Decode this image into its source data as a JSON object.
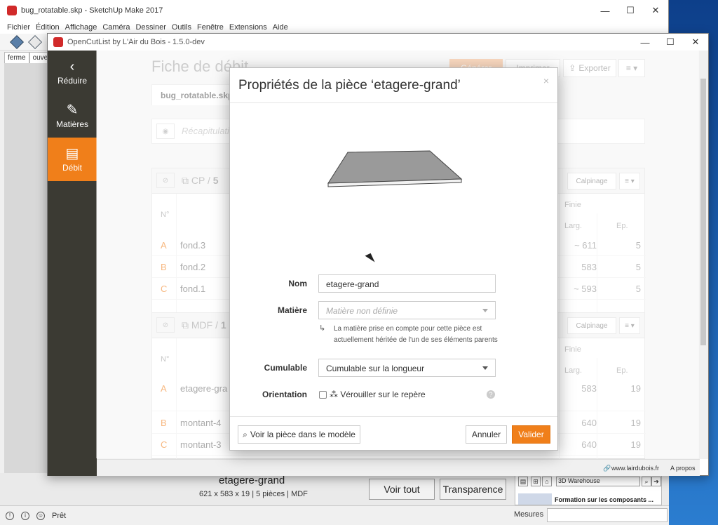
{
  "sketchup": {
    "title": "bug_rotatable.skp - SketchUp Make 2017",
    "menu": [
      "Fichier",
      "Édition",
      "Affichage",
      "Caméra",
      "Dessiner",
      "Outils",
      "Fenêtre",
      "Extensions",
      "Aide"
    ],
    "scene_tabs": [
      "ferme",
      "ouvert"
    ],
    "selected_piece": "etagere-grand",
    "selected_dims": "621 x 583 x 19 | 5 pièces | MDF",
    "btn_voir_tout": "Voir tout",
    "btn_transparence": "Transparence",
    "warehouse_field": "3D Warehouse",
    "warehouse_promo": "Formation sur les composants ...",
    "status": "Prêt",
    "mesures_label": "Mesures"
  },
  "ocl": {
    "title": "OpenCutList by L'Air du Bois - 1.5.0-dev",
    "sidebar": [
      {
        "label": "Réduire",
        "icon": "‹"
      },
      {
        "label": "Matières",
        "icon": "✎"
      },
      {
        "label": "Débit",
        "icon": "▤"
      }
    ],
    "page_title": "Fiche de débit",
    "btn_generate": "Générer",
    "btn_print": "Imprimer",
    "btn_export": "Exporter",
    "file_tab": "bug_rotatable.skp",
    "recap_label": "Récapitulatif",
    "btn_calpinage": "Calpinage",
    "col_num": "N°",
    "col_finie": "Finie",
    "col_larg": "Larg.",
    "col_ep": "Ep.",
    "groups": [
      {
        "name": "CP",
        "count": "5",
        "rows": [
          {
            "letter": "A",
            "name": "fond.3",
            "larg": "~ 611",
            "ep": "5"
          },
          {
            "letter": "B",
            "name": "fond.2",
            "larg": "583",
            "ep": "5"
          },
          {
            "letter": "C",
            "name": "fond.1",
            "larg": "~ 593",
            "ep": "5"
          }
        ]
      },
      {
        "name": "MDF",
        "count": "1",
        "rows": [
          {
            "letter": "A",
            "name": "etagere-gra",
            "larg": "583",
            "ep": "19"
          },
          {
            "letter": "B",
            "name": "montant-4",
            "larg": "640",
            "ep": "19"
          },
          {
            "letter": "C",
            "name": "montant-3",
            "larg": "640",
            "ep": "19"
          }
        ]
      }
    ],
    "footer_link": "www.lairdubois.fr",
    "footer_about": "A propos"
  },
  "modal": {
    "title": "Propriétés de la pièce ‘etagere-grand’",
    "close": "×",
    "label_nom": "Nom",
    "value_nom": "etagere-grand",
    "label_matiere": "Matière",
    "placeholder_matiere": "Matière non définie",
    "help_matiere": "La matière prise en compte pour cette pièce est actuellement héritée de l'un de ses éléments parents",
    "label_cumulable": "Cumulable",
    "value_cumulable": "Cumulable sur la longueur",
    "label_orientation": "Orientation",
    "check_orientation": "Vérouiller sur le repère",
    "btn_view": "Voir la pièce dans le modèle",
    "btn_cancel": "Annuler",
    "btn_validate": "Valider"
  }
}
